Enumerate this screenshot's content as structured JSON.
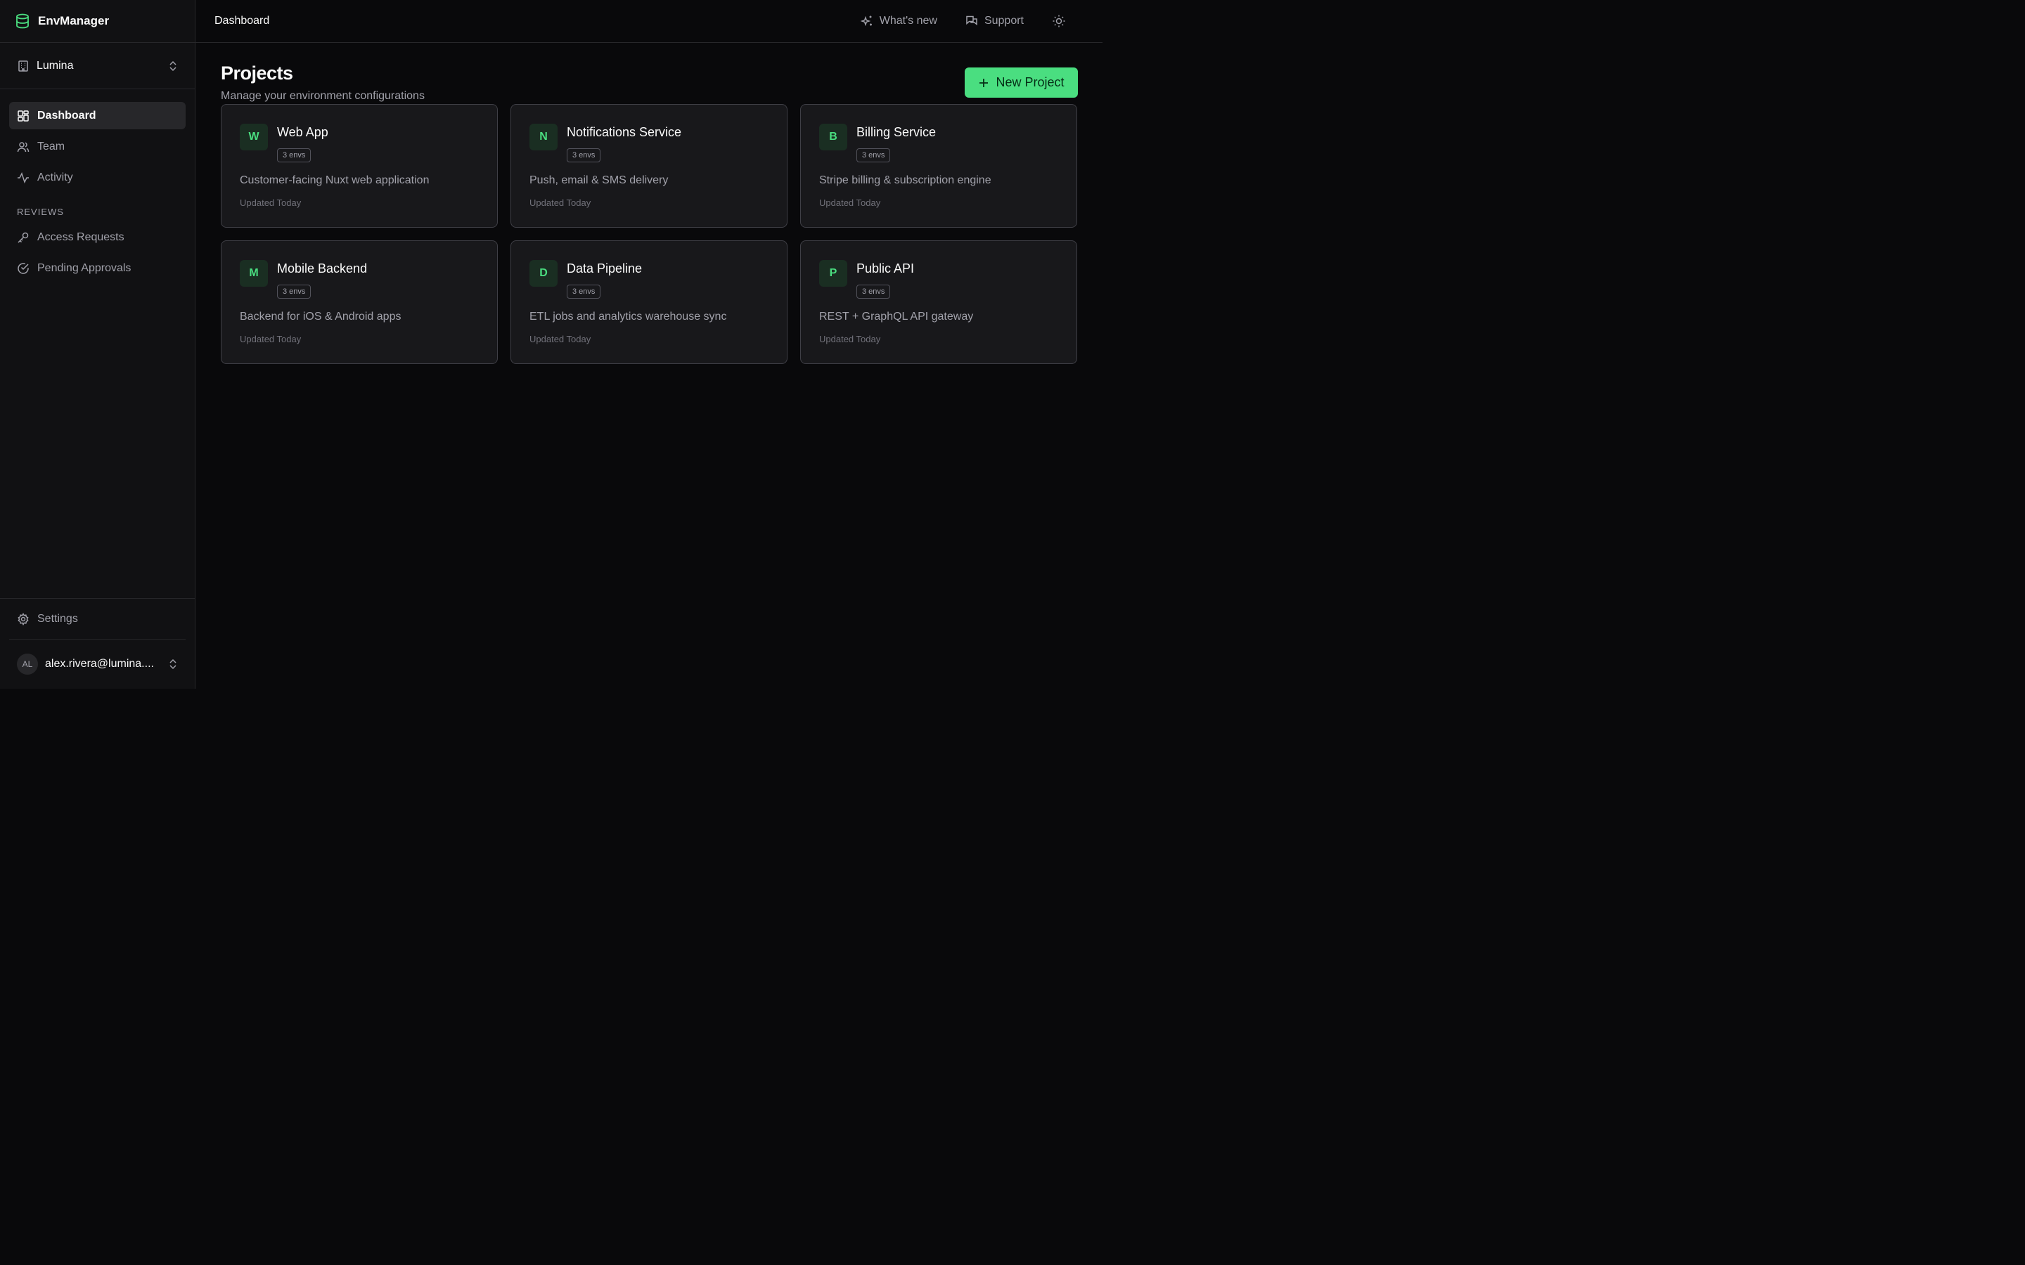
{
  "app": {
    "name": "EnvManager",
    "accent": "#4ade80"
  },
  "org": {
    "name": "Lumina"
  },
  "sidebar": {
    "items": [
      {
        "label": "Dashboard",
        "icon": "dashboard-icon"
      },
      {
        "label": "Team",
        "icon": "users-icon"
      },
      {
        "label": "Activity",
        "icon": "activity-icon"
      }
    ],
    "section_label": "REVIEWS",
    "review_items": [
      {
        "label": "Access Requests",
        "icon": "key-icon"
      },
      {
        "label": "Pending Approvals",
        "icon": "check-circle-icon"
      }
    ],
    "settings_label": "Settings",
    "user": {
      "initials": "AL",
      "email": "alex.rivera@lumina...."
    }
  },
  "topbar": {
    "title": "Dashboard",
    "whats_new": "What's new",
    "support": "Support"
  },
  "main": {
    "title": "Projects",
    "subtitle": "Manage your environment configurations",
    "new_project_label": "New Project",
    "projects": [
      {
        "letter": "W",
        "name": "Web App",
        "envs": "3 envs",
        "description": "Customer-facing Nuxt web application",
        "updated": "Updated Today"
      },
      {
        "letter": "N",
        "name": "Notifications Service",
        "envs": "3 envs",
        "description": "Push, email & SMS delivery",
        "updated": "Updated Today"
      },
      {
        "letter": "B",
        "name": "Billing Service",
        "envs": "3 envs",
        "description": "Stripe billing & subscription engine",
        "updated": "Updated Today"
      },
      {
        "letter": "M",
        "name": "Mobile Backend",
        "envs": "3 envs",
        "description": "Backend for iOS & Android apps",
        "updated": "Updated Today"
      },
      {
        "letter": "D",
        "name": "Data Pipeline",
        "envs": "3 envs",
        "description": "ETL jobs and analytics warehouse sync",
        "updated": "Updated Today"
      },
      {
        "letter": "P",
        "name": "Public API",
        "envs": "3 envs",
        "description": "REST + GraphQL API gateway",
        "updated": "Updated Today"
      }
    ]
  }
}
